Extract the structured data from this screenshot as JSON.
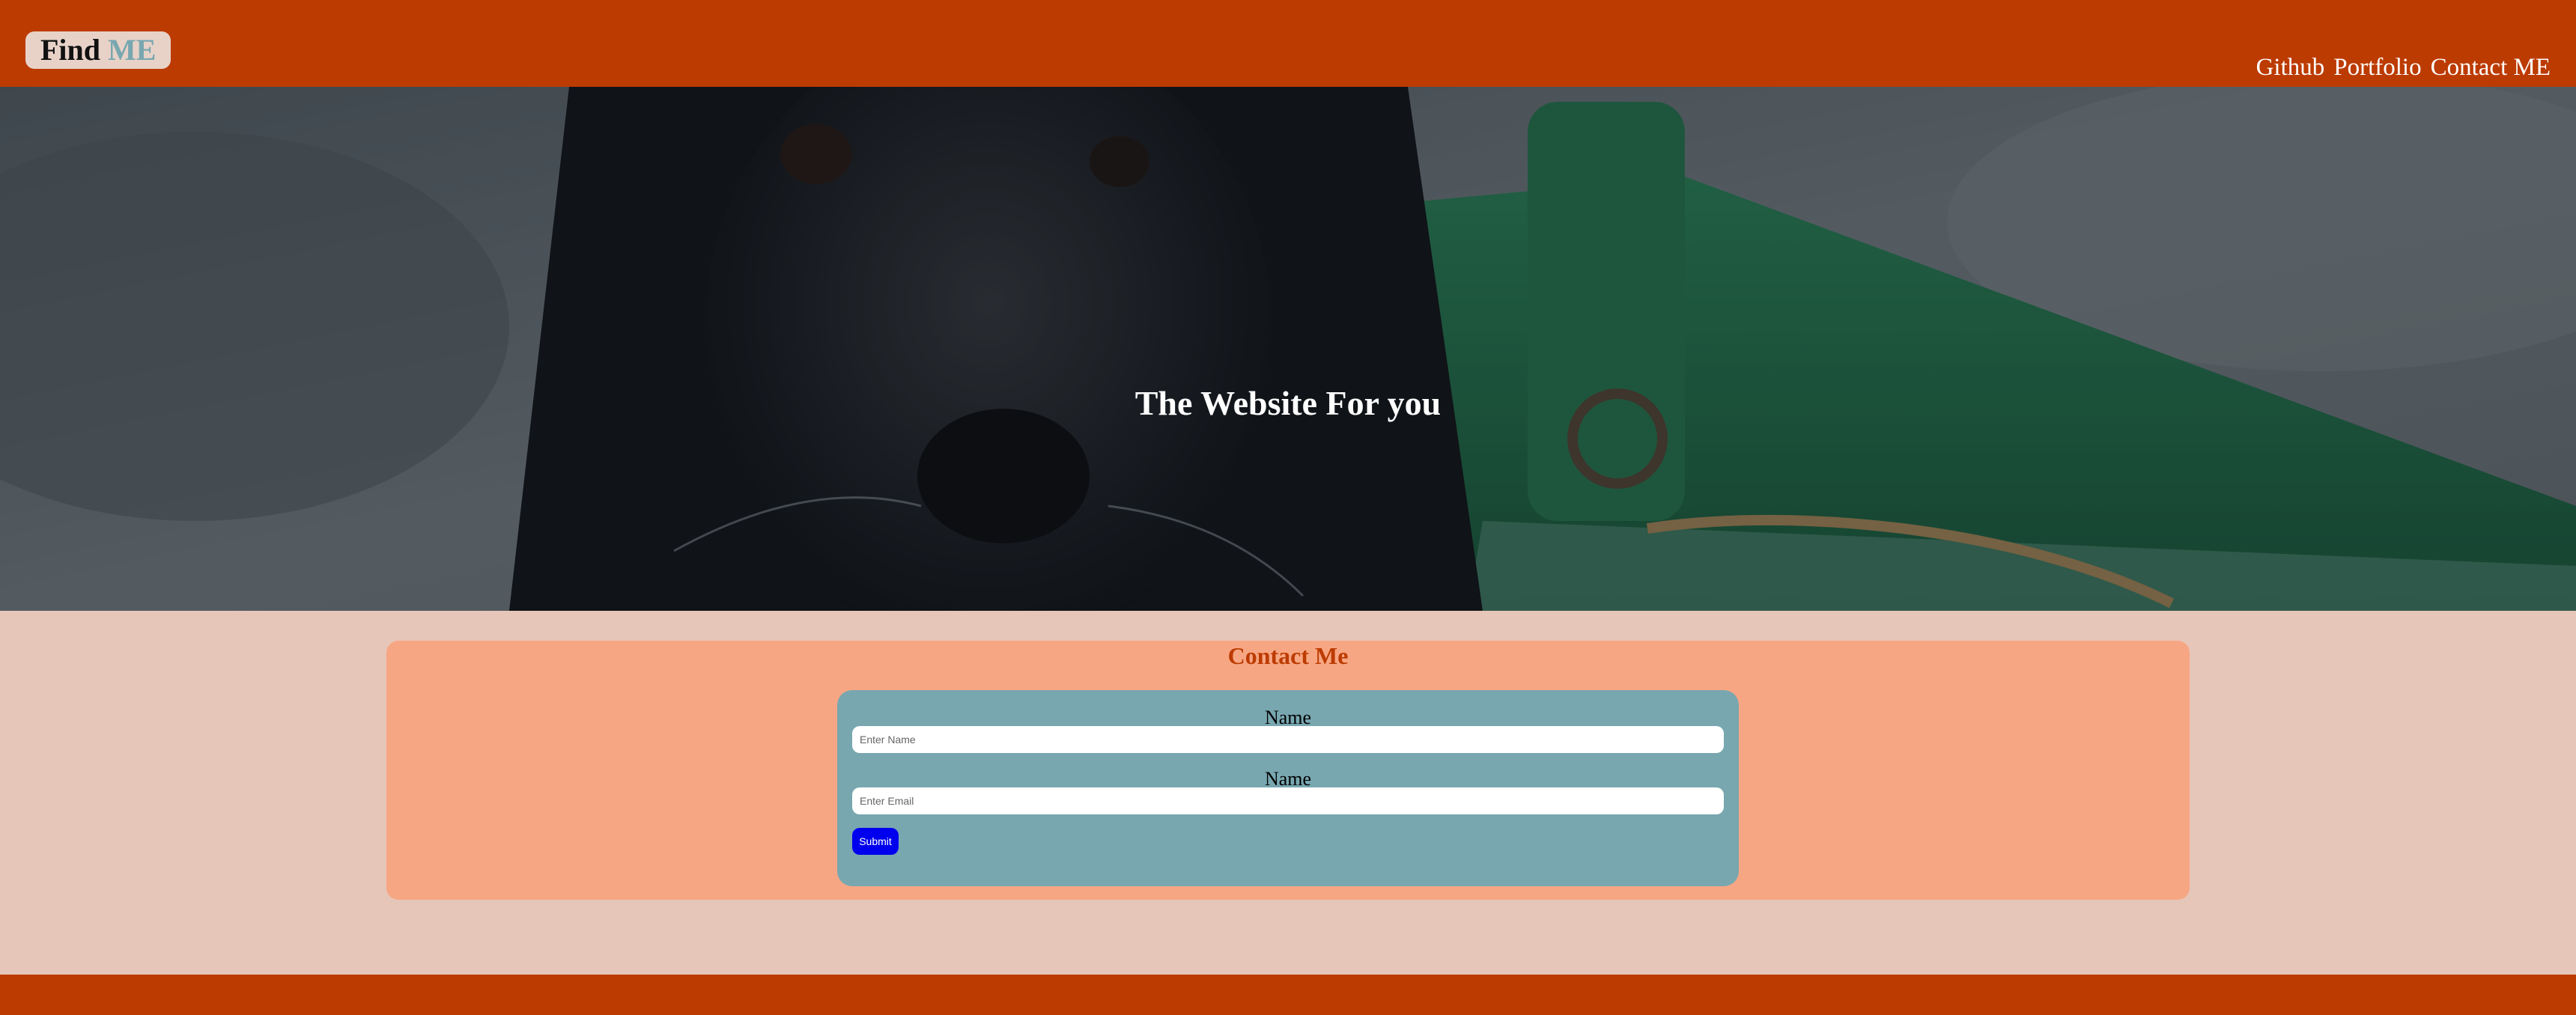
{
  "header": {
    "logo_word1": "Find",
    "logo_word2": "ME",
    "nav": [
      "Github",
      "Portfolio",
      "Contact ME"
    ]
  },
  "hero": {
    "title": "The Website For you"
  },
  "contact": {
    "title": "Contact Me",
    "name_label": "Name",
    "name_placeholder": "Enter Name",
    "email_label": "Name",
    "email_placeholder": "Enter Email",
    "submit_label": "Submit"
  },
  "colors": {
    "header_bg": "#bc3b00",
    "page_bg": "#e6c6b8",
    "card_bg": "#f7a683",
    "form_bg": "#78a7b0",
    "button_bg": "#0000ee"
  }
}
